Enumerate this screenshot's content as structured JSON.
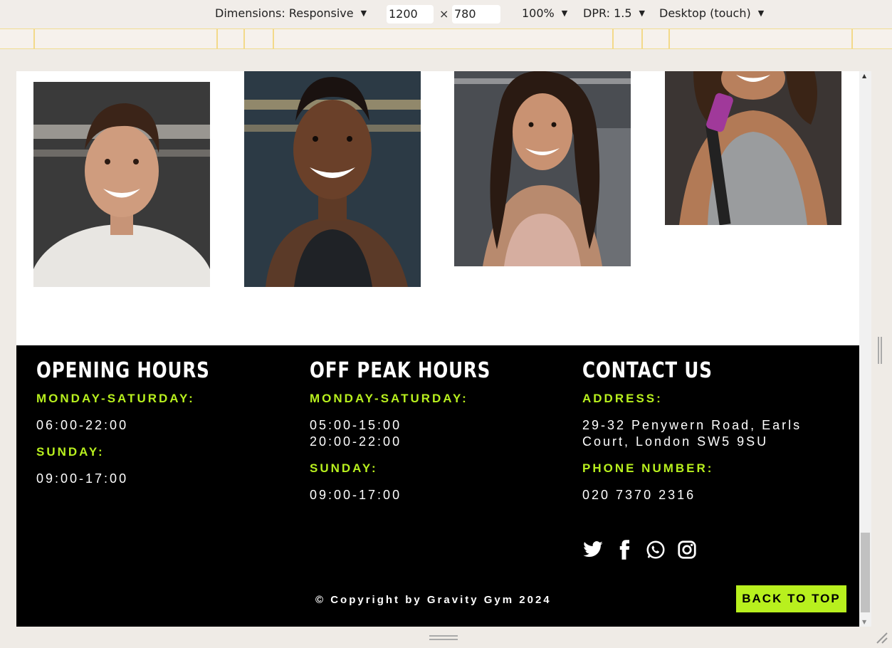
{
  "toolbar": {
    "dimensions_label": "Dimensions: Responsive",
    "width_value": "1200",
    "height_value": "780",
    "times_symbol": "×",
    "zoom_label": "100%",
    "dpr_label": "DPR: 1.5",
    "device_label": "Desktop (touch)"
  },
  "photos": [
    {
      "name": "trainer-1"
    },
    {
      "name": "trainer-2"
    },
    {
      "name": "trainer-3"
    },
    {
      "name": "trainer-4"
    }
  ],
  "footer": {
    "opening": {
      "title": "OPENING HOURS",
      "weekday_label": "MONDAY-SATURDAY:",
      "weekday_hours": "06:00-22:00",
      "sunday_label": "SUNDAY:",
      "sunday_hours": "09:00-17:00"
    },
    "offpeak": {
      "title": "OFF PEAK HOURS",
      "weekday_label": "MONDAY-SATURDAY:",
      "weekday_hours": "05:00-15:00\n20:00-22:00",
      "sunday_label": "SUNDAY:",
      "sunday_hours": "09:00-17:00"
    },
    "contact": {
      "title": "CONTACT US",
      "address_label": "ADDRESS:",
      "address": "29-32 Penywern Road, Earls\nCourt, London SW5 9SU",
      "phone_label": "PHONE NUMBER:",
      "phone": "020 7370 2316"
    },
    "social_icons": [
      "twitter-icon",
      "facebook-icon",
      "whatsapp-icon",
      "instagram-icon"
    ],
    "copyright": "© Copyright by Gravity Gym 2024",
    "back_to_top": "BACK TO TOP"
  },
  "colors": {
    "accent": "#b8f01e",
    "footer_bg": "#000000"
  }
}
